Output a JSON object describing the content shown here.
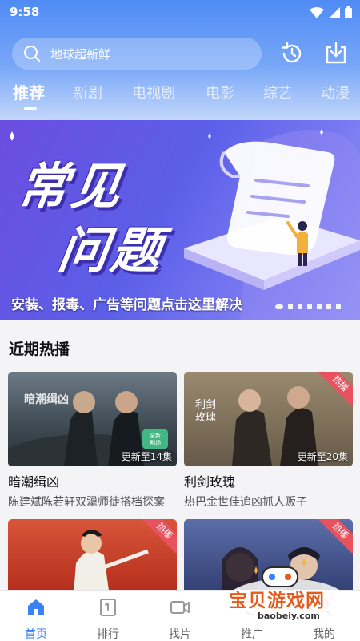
{
  "status_bar": {
    "time": "9:58"
  },
  "search": {
    "placeholder": "地球超新鲜"
  },
  "tabs": [
    {
      "label": "推荐",
      "active": true
    },
    {
      "label": "新剧"
    },
    {
      "label": "电视剧"
    },
    {
      "label": "电影"
    },
    {
      "label": "综艺"
    },
    {
      "label": "动漫"
    }
  ],
  "banner": {
    "title_line1": "常见",
    "title_line2": "问题",
    "caption": "安装、报毒、广告等问题点击这里解决",
    "dot_count": 7,
    "active_dot": 0
  },
  "section": {
    "title": "近期热播"
  },
  "cards": [
    {
      "title": "暗潮缉凶",
      "subtitle": "陈建斌陈若轩双犟师徒搭档探案",
      "episode": "更新至14集",
      "poster_text": "暗潮缉凶",
      "poster_badge": "全新\n剧场"
    },
    {
      "title": "利剑玫瑰",
      "subtitle": "热巴金世佳追凶抓人贩子",
      "episode": "更新至20集",
      "badge": "热播",
      "poster_text": "利剑\n玫瑰"
    },
    {
      "title": "",
      "subtitle": "",
      "badge": "热播"
    },
    {
      "title": "",
      "subtitle": "",
      "badge": "热播"
    }
  ],
  "bottom_nav": [
    {
      "label": "首页",
      "icon": "home-icon",
      "active": true
    },
    {
      "label": "排行",
      "icon": "ranking-icon"
    },
    {
      "label": "找片",
      "icon": "video-camera-icon"
    },
    {
      "label": "推广",
      "icon": "share-icon"
    },
    {
      "label": "我的",
      "icon": "user-icon"
    }
  ],
  "watermark": {
    "text": "宝贝游戏网",
    "url": "baobeiy.com"
  },
  "colors": {
    "accent": "#3b82f6",
    "header_top": "#4f8bf5",
    "hot_badge": "#e8525f",
    "banner": "#6b4de0"
  }
}
